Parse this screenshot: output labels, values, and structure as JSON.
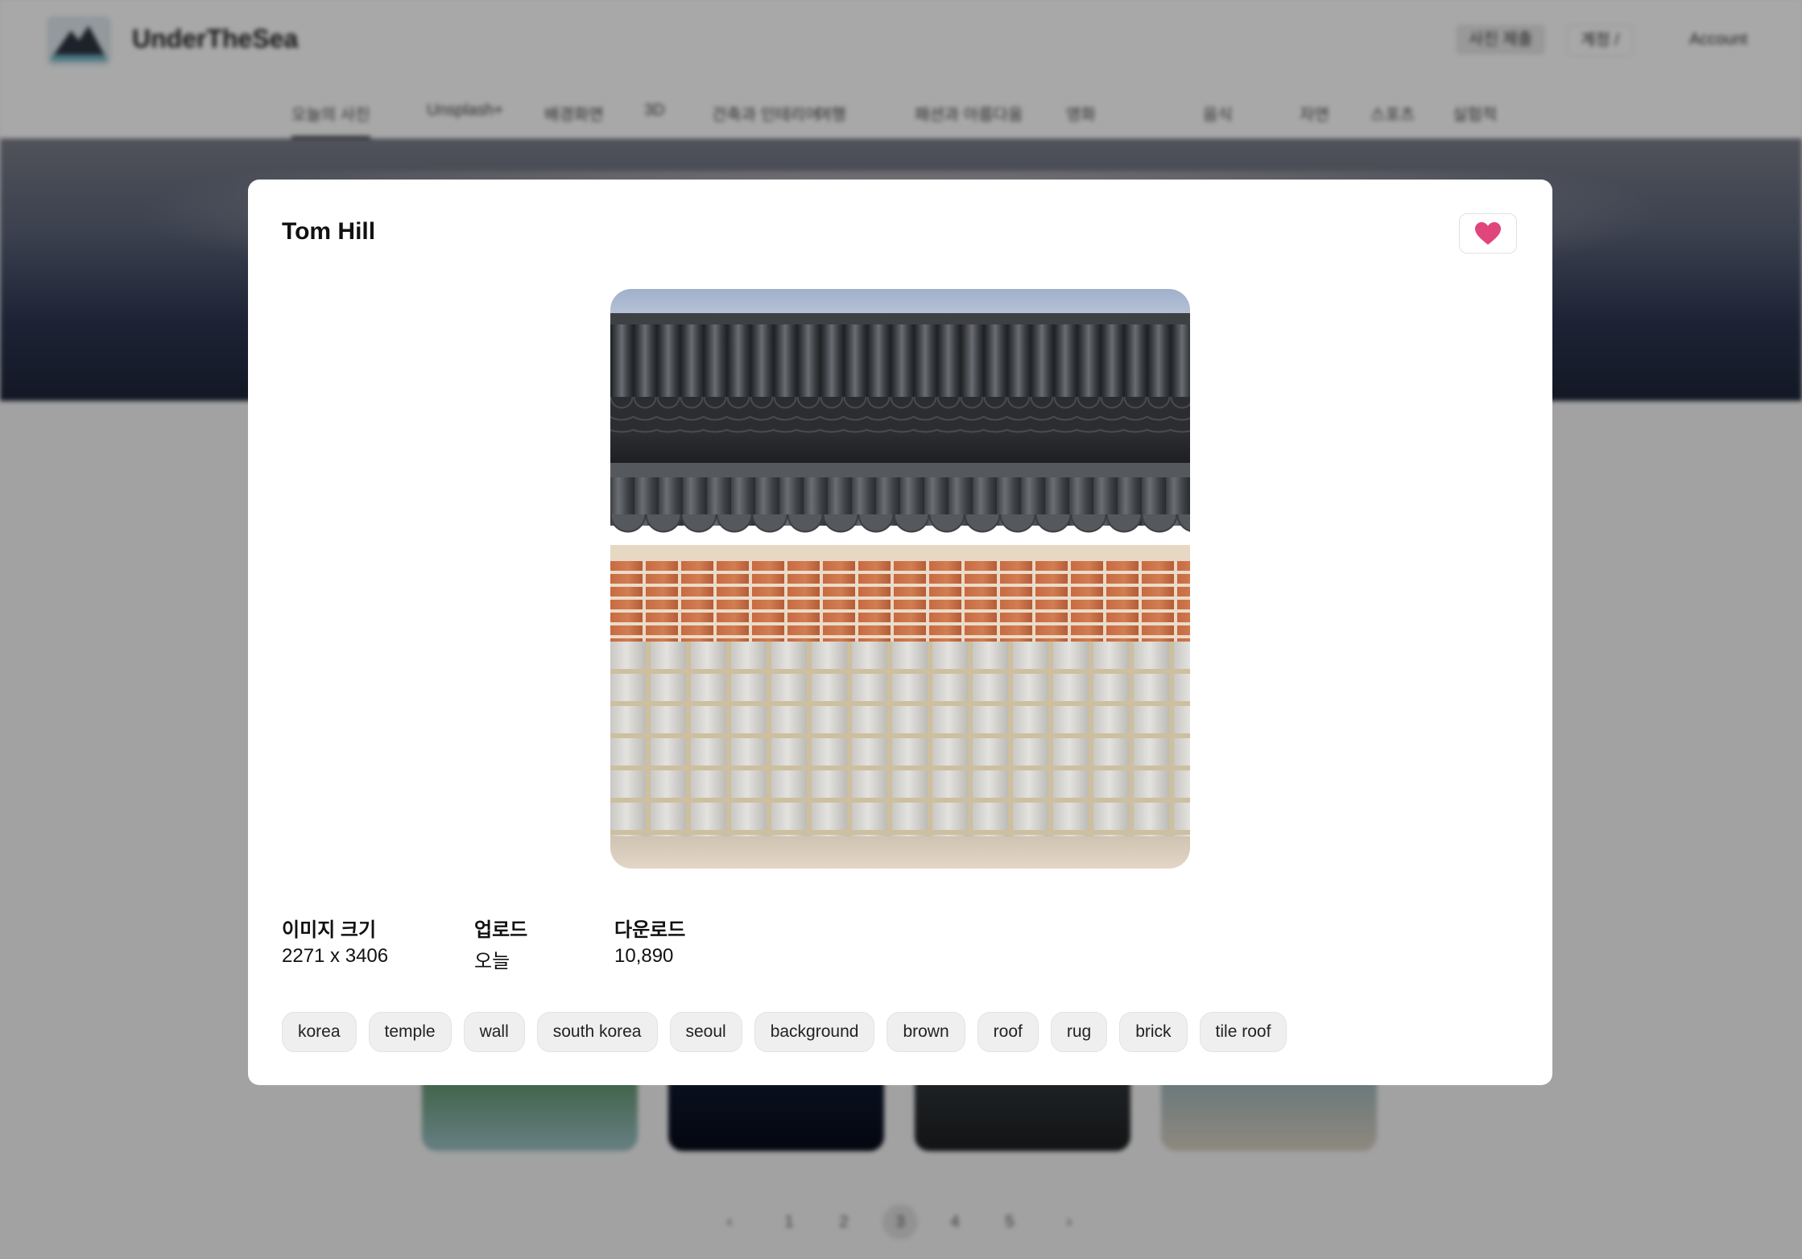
{
  "site": {
    "logo_text": "UnderTheSea",
    "top_buttons": [
      "사진 제출",
      "계정 / ",
      "Account"
    ],
    "categories": [
      "오늘의 사진",
      "Unsplash+",
      "배경화면",
      "3D",
      "건축과 인테리어",
      "여행",
      "패션과 아름다움",
      "영화",
      "음식",
      "자연",
      "스포츠",
      "실험적"
    ],
    "pagination": [
      "‹",
      "1",
      "2",
      "3",
      "4",
      "5",
      "›"
    ]
  },
  "modal": {
    "author": "Tom Hill",
    "like_icon": "heart-icon",
    "like_color": "#e0457b",
    "meta": [
      {
        "label": "이미지 크기",
        "value": "2271 x 3406"
      },
      {
        "label": "업로드",
        "value": "오늘"
      },
      {
        "label": "다운로드",
        "value": "10,890"
      }
    ],
    "tags": [
      "korea",
      "temple",
      "wall",
      "south korea",
      "seoul",
      "background",
      "brown",
      "roof",
      "rug",
      "brick",
      "tile roof"
    ]
  }
}
